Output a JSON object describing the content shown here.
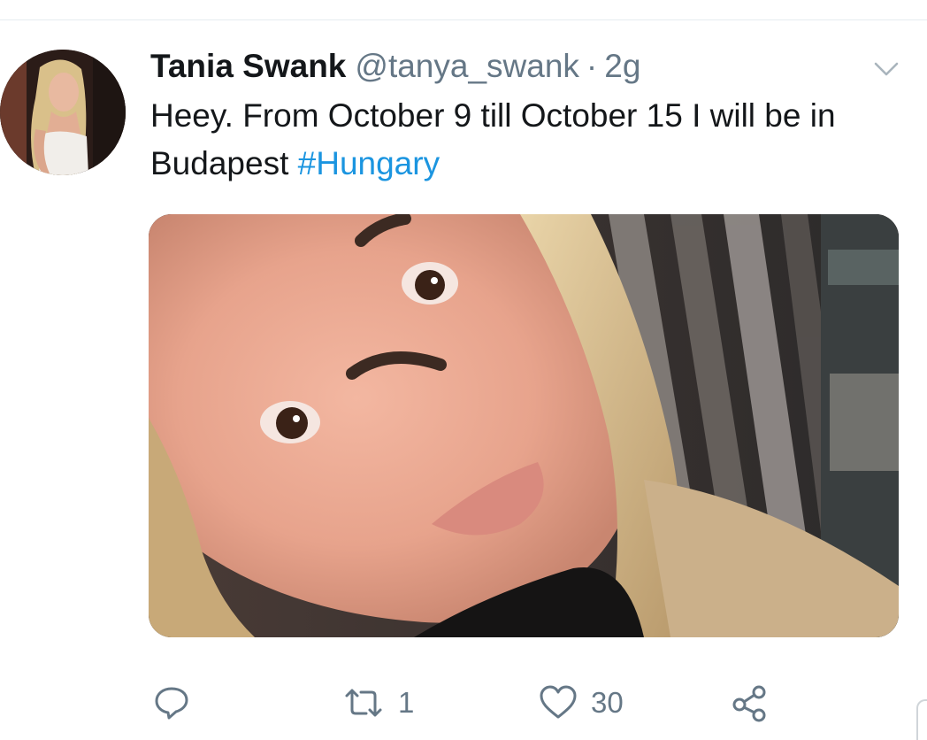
{
  "tweet": {
    "display_name": "Tania Swank",
    "handle": "@tanya_swank",
    "separator": "·",
    "time": "2g",
    "text_before": "Heey. From October 9 till October 15 I will be in Budapest ",
    "hashtag": "#Hungary",
    "avatar_icon": "profile-photo",
    "media_icon": "selfie-photo"
  },
  "actions": {
    "reply_icon": "speech-bubble-icon",
    "retweet_count": "1",
    "like_count": "30",
    "share_icon": "share-nodes-icon"
  },
  "colors": {
    "text": "#14171a",
    "secondary": "#657786",
    "link": "#1b95e0",
    "icon": "#657786"
  }
}
